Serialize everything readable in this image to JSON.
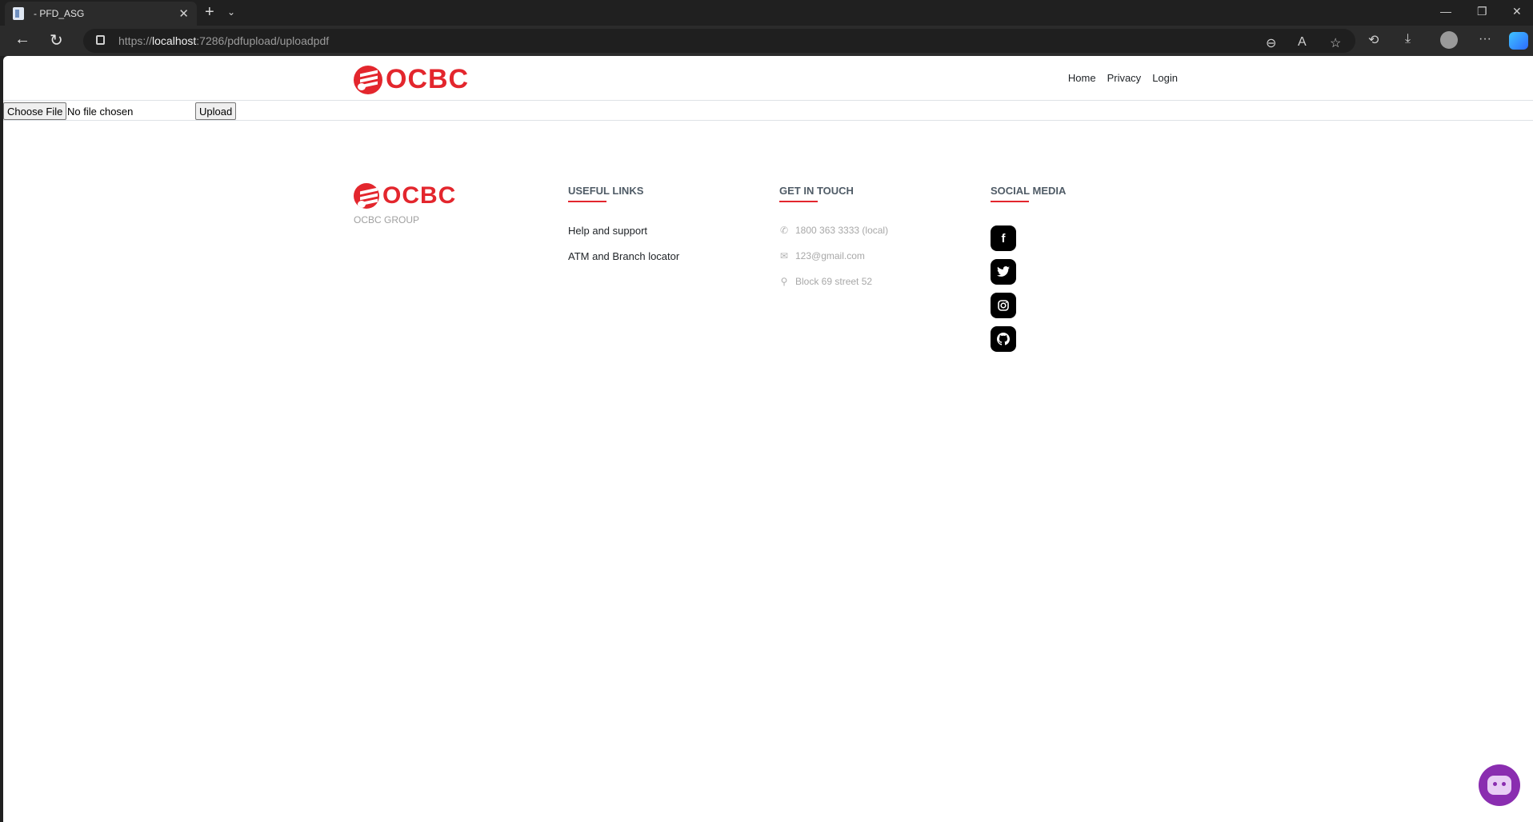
{
  "browser": {
    "tab_title": "- PFD_ASG",
    "url_prefix": "https://",
    "url_host": "localhost",
    "url_rest": ":7286/pdfupload/uploadpdf"
  },
  "header": {
    "logo_text": "OCBC",
    "nav": [
      "Home",
      "Privacy",
      "Login"
    ]
  },
  "upload": {
    "choose_label": "Choose File",
    "file_status": "No file chosen",
    "upload_label": "Upload"
  },
  "footer": {
    "logo_text": "OCBC",
    "group_label": "OCBC GROUP",
    "useful_links": {
      "title": "USEFUL LINKS",
      "items": [
        "Help and support",
        "ATM and Branch locator"
      ]
    },
    "get_in_touch": {
      "title": "GET IN TOUCH",
      "phone": "1800 363 3333 (local)",
      "email": "123@gmail.com",
      "address": "Block 69 street 52"
    },
    "social_media": {
      "title": "SOCIAL MEDIA",
      "icons": [
        "facebook-icon",
        "twitter-icon",
        "instagram-icon",
        "github-icon"
      ]
    }
  },
  "colors": {
    "brand_red": "#e3262d",
    "chatbot_purple": "#8a2db0"
  }
}
